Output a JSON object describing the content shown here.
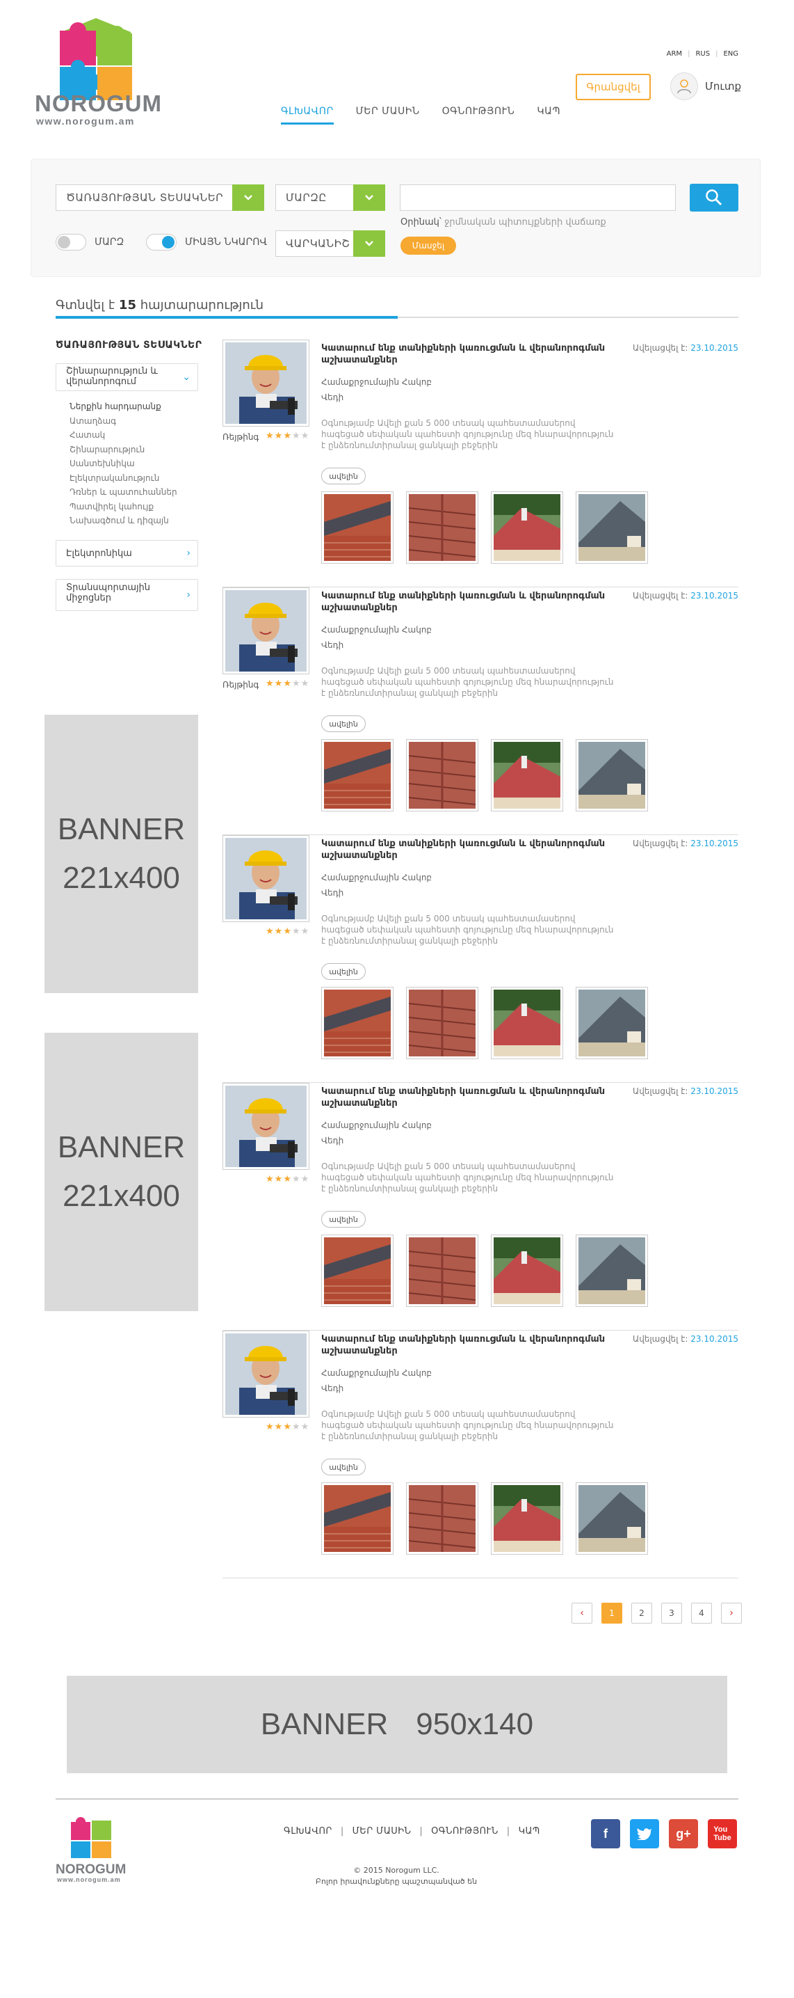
{
  "header": {
    "logo_name": "NOROGUM",
    "logo_url": "www.norogum.am",
    "languages": [
      "ARM",
      "RUS",
      "ENG"
    ],
    "register_label": "Գրանցվել",
    "login_label": "Մուտք",
    "nav": [
      "ԳԼԽԱՎՈՐ",
      "ՄԵՐ ՄԱՍԻՆ",
      "ՕԳՆՈՒԹՅՈՒՆ",
      "ԿԱՊ"
    ]
  },
  "search": {
    "category_select": "ԾԱՌԱՅՈՒԹՅԱՆ ՏԵՍԱԿՆԵՐ",
    "region_select": "ՄԱՐԶԸ",
    "city_select": "ՎԱՐԿԱՆԻՇ",
    "input_placeholder": "",
    "example_label": "Օրինակ՝",
    "example_text": "ջրմնական պիտույքների վաճառք",
    "find_label": "Մասջել",
    "toggle_region_label": "ՄԱՐԶ",
    "toggle_single_label": "ՄԻԱՅՆ ՆԿԱՐՈՎ",
    "toggle_region_on": false,
    "toggle_single_on": true
  },
  "results": {
    "found_prefix": "Գտնվել է",
    "found_count": "15",
    "found_suffix": "հայտարարություն"
  },
  "sidebar": {
    "title": "ԾԱՌԱՅՈՒԹՅԱՆ ՏԵՍԱԿՆԵՐ",
    "box1": "Շինարարություն և վերանորոգում",
    "sub_items": [
      "Ներքին հարդարանք",
      "Ատաղձագ",
      "Հատակ",
      "Շինարարություն",
      "Սանտեխնիկա",
      "Էլեկտրականություն",
      "Դռներ և պատուհաններ",
      "Պատվիրել կահույք",
      "Նախագծում և դիզայն"
    ],
    "box2": "Էլեկտրոնիկա",
    "box3": "Տրանսպորտային միջոցներ",
    "banner1": [
      "BANNER",
      "221x400"
    ],
    "banner2": [
      "BANNER",
      "221x400"
    ]
  },
  "listings": [
    {
      "title": "Կատարում ենք տանիքների կառուցման և վերանորոգման աշխատանքներ",
      "date_label": "Ավելացվել է:",
      "date": "23.10.2015",
      "category": "Համաքրջումային Հակոբ",
      "location": "Վեդի",
      "desc": "Օգնությամբ Ավելի քան 5 000 տեսակ պահեստամասերով հագեցած սեփական պահեստի գոյությունը մեզ հնարավորություն է ընձեռնումտիրանալ ցանկալի բեջերին",
      "more": "ավելին",
      "rating_label": "Ռեյթինգ",
      "stars": 3
    },
    {
      "title": "Կատարում ենք տանիքների կառուցման և վերանորոգման աշխատանքներ",
      "date_label": "Ավելացվել է:",
      "date": "23.10.2015",
      "category": "Համաքրջումային Հակոբ",
      "location": "Վեդի",
      "desc": "Օգնությամբ Ավելի քան 5 000 տեսակ պահեստամասերով հագեցած սեփական պահեստի գոյությունը մեզ հնարավորություն է ընձեռնումտիրանալ ցանկալի բեջերին",
      "more": "ավելին",
      "rating_label": "Ռեյթինգ",
      "stars": 3
    },
    {
      "title": "Կատարում ենք տանիքների կառուցման և վերանորոգման աշխատանքներ",
      "date_label": "Ավելացվել է:",
      "date": "23.10.2015",
      "category": "Համաքրջումային Հակոբ",
      "location": "Վեդի",
      "desc": "Օգնությամբ Ավելի քան 5 000 տեսակ պահեստամասերով հագեցած սեփական պահեստի գոյությունը մեզ հնարավորություն է ընձեռնումտիրանալ ցանկալի բեջերին",
      "more": "ավելին",
      "rating_label": "",
      "stars": 3
    },
    {
      "title": "Կատարում ենք տանիքների կառուցման և վերանորոգման աշխատանքներ",
      "date_label": "Ավելացվել է:",
      "date": "23.10.2015",
      "category": "Համաքրջումային Հակոբ",
      "location": "Վեդի",
      "desc": "Օգնությամբ Ավելի քան 5 000 տեսակ պահեստամասերով հագեցած սեփական պահեստի գոյությունը մեզ հնարավորություն է ընձեռնումտիրանալ ցանկալի բեջերին",
      "more": "ավելին",
      "rating_label": "",
      "stars": 3
    },
    {
      "title": "Կատարում ենք տանիքների կառուցման և վերանորոգման աշխատանքներ",
      "date_label": "Ավելացվել է:",
      "date": "23.10.2015",
      "category": "Համաքրջումային Հակոբ",
      "location": "Վեդի",
      "desc": "Օգնությամբ Ավելի քան 5 000 տեսակ պահեստամասերով հագեցած սեփական պահեստի գոյությունը մեզ հնարավորություն է ընձեռնումտիրանալ ցանկալի բեջերին",
      "more": "ավելին",
      "rating_label": "",
      "stars": 3
    }
  ],
  "pagination": {
    "pages": [
      "1",
      "2",
      "3",
      "4"
    ],
    "active": "1",
    "prev": "‹",
    "next": "›"
  },
  "bottom_banner": [
    "BANNER",
    "950x140"
  ],
  "footer": {
    "logo_name": "NOROGUM",
    "logo_url": "www.norogum.am",
    "nav": [
      "ԳԼԽԱՎՈՐ",
      "ՄԵՐ ՄԱՍԻՆ",
      "ՕԳՆՈՒԹՅՈՒՆ",
      "ԿԱՊ"
    ],
    "copyright": "© 2015 Norogum LLC.",
    "rights": "Բոլոր իրավունքները պաշտպանված են",
    "social": [
      "facebook-icon",
      "twitter-icon",
      "google-plus-icon",
      "youtube-icon"
    ]
  },
  "colors": {
    "accent": "#1ea3e0",
    "orange": "#f7a830",
    "green": "#8cc63f"
  }
}
